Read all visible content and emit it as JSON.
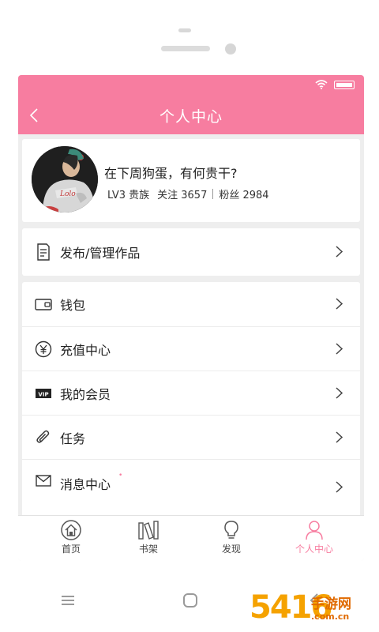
{
  "header": {
    "title": "个人中心",
    "accent_color": "#f77da0",
    "back_icon": "chevron-left-icon"
  },
  "profile": {
    "name": "在下周狗蛋，有何贵干?",
    "level": "LV3 贵族",
    "following": "关注 3657",
    "followers": "粉丝 2984"
  },
  "works": {
    "label": "发布/管理作品",
    "icon": "document-icon"
  },
  "menu": [
    {
      "label": "钱包",
      "icon": "wallet-icon"
    },
    {
      "label": "充值中心",
      "icon": "yen-coin-icon"
    },
    {
      "label": "我的会员",
      "icon": "vip-icon"
    },
    {
      "label": "任务",
      "icon": "paperclip-icon"
    },
    {
      "label": "消息中心",
      "icon": "mail-icon",
      "badge_dot": "•"
    }
  ],
  "tabs": [
    {
      "label": "首页",
      "icon": "home-icon"
    },
    {
      "label": "书架",
      "icon": "bookshelf-icon"
    },
    {
      "label": "发现",
      "icon": "lightbulb-icon"
    },
    {
      "label": "个人中心",
      "icon": "person-icon",
      "active": true
    }
  ],
  "system_nav": [
    "menu-icon",
    "home-circle-icon",
    "back-icon"
  ],
  "watermark": {
    "number": "5416",
    "text": "手游网",
    "url": ".com.cn"
  }
}
